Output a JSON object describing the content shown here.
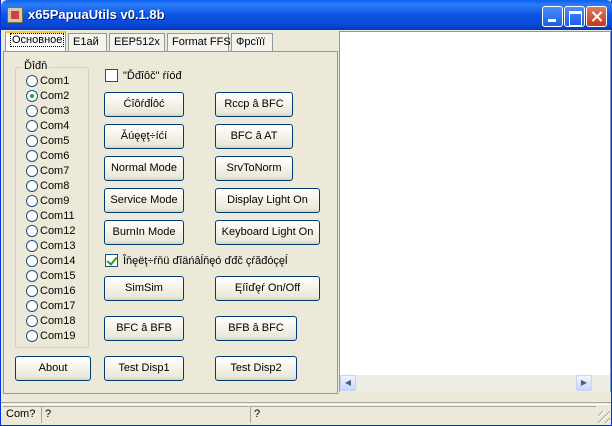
{
  "window": {
    "title": "x65PapuaUtils v0.1.8b"
  },
  "tabs": [
    {
      "label": "Основное"
    },
    {
      "label": "Е1ай"
    },
    {
      "label": "EEP512x"
    },
    {
      "label": "Format FFS"
    },
    {
      "label": "Фрсїїї"
    }
  ],
  "port_group": {
    "title": "Ďîđň",
    "ports": [
      "Com1",
      "Com2",
      "Com3",
      "Com4",
      "Com5",
      "Com6",
      "Com7",
      "Com8",
      "Com9",
      "Com11",
      "Com12",
      "Com13",
      "Com14",
      "Com15",
      "Com16",
      "Com17",
      "Com18",
      "Com19"
    ],
    "selected": "Com2"
  },
  "controls": {
    "checkbox_top": {
      "label": "\"Ďđîôč\" ŕíóđ",
      "checked": false
    },
    "btn_1": "Ćîôŕđĺôć",
    "btn_rccp": "Rccp â BFC",
    "btn_2": "Ăúęęţ÷íćí",
    "btn_bfc_at": "BFC â AT",
    "btn_normal_mode": "Normal Mode",
    "btn_srv_to_norm": "SrvToNorm",
    "btn_service_mode": "Service Mode",
    "btn_display_light": "Display Light On",
    "btn_burnin_mode": "BurnIn Mode",
    "btn_keyboard_light": "Keyboard Light On",
    "checkbox_bottom": {
      "label": "Îňęëţ÷ŕňü ďîäńâĺňęó ďđč çŕăđóçęĺ",
      "checked": true
    },
    "btn_simsim": "SimSim",
    "btn_onoff": "Ęíîďęŕ On/Off",
    "btn_bfc_bfb": "BFC â BFB",
    "btn_bfb_bfc": "BFB â BFC",
    "btn_about": "About",
    "btn_test_disp1": "Test Disp1",
    "btn_test_disp2": "Test Disp2"
  },
  "status": {
    "cell_1": "Com?",
    "cell_2": "?",
    "cell_3": "?"
  },
  "colors": {
    "titlebar": "#0a55e5",
    "background": "#ece9d8",
    "button_border": "#003c74",
    "check_mark": "#21a121"
  }
}
